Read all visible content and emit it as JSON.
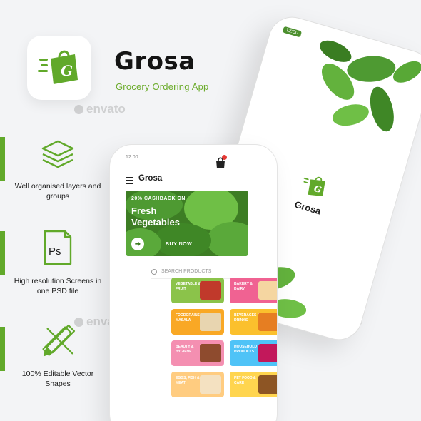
{
  "brand": {
    "name": "Grosa",
    "tagline": "Grocery Ordering App",
    "icon": "shopping-bag-g-icon",
    "accent": "#61a92a"
  },
  "watermark": "envato",
  "features": [
    {
      "icon": "layers-icon",
      "label": "Well organised layers and groups"
    },
    {
      "icon": "photoshop-icon",
      "label_1": "Ps",
      "label": "High resolution Screens in one PSD file"
    },
    {
      "icon": "pencil-ruler-icon",
      "label": "100% Editable Vector Shapes"
    }
  ],
  "phone_home": {
    "status_time": "12:00",
    "title": "Grosa",
    "cart_icon": "shopping-bag-icon",
    "hero": {
      "line1": "20% CASHBACK ON",
      "line2": "Fresh Vegetables",
      "cta": "BUY NOW"
    },
    "search_placeholder": "SEARCH PRODUCTS",
    "categories": [
      {
        "label": "Vegetable & Fruit",
        "color": "#8bc34a",
        "pic": "#c0392b"
      },
      {
        "label": "Bakery & Dairy",
        "color": "#f06292",
        "pic": "#f5d6a1"
      },
      {
        "label": "Foodgrains & Masala",
        "color": "#f9a825",
        "pic": "#e8d5b0"
      },
      {
        "label": "Beverages & Drinks",
        "color": "#fbc02d",
        "pic": "#e67e22"
      },
      {
        "label": "Beauty & Hygiene",
        "color": "#f48fb1",
        "pic": "#8e4b2e"
      },
      {
        "label": "Household Products",
        "color": "#4fc3f7",
        "pic": "#c2185b"
      },
      {
        "label": "Eggs, Fish & Meat",
        "color": "#ffcc80",
        "pic": "#f4e1c1"
      },
      {
        "label": "Pet Food & Care",
        "color": "#ffd54f",
        "pic": "#8d5524"
      }
    ]
  },
  "phone_splash": {
    "status_time": "12:00",
    "brand": "Grosa"
  }
}
